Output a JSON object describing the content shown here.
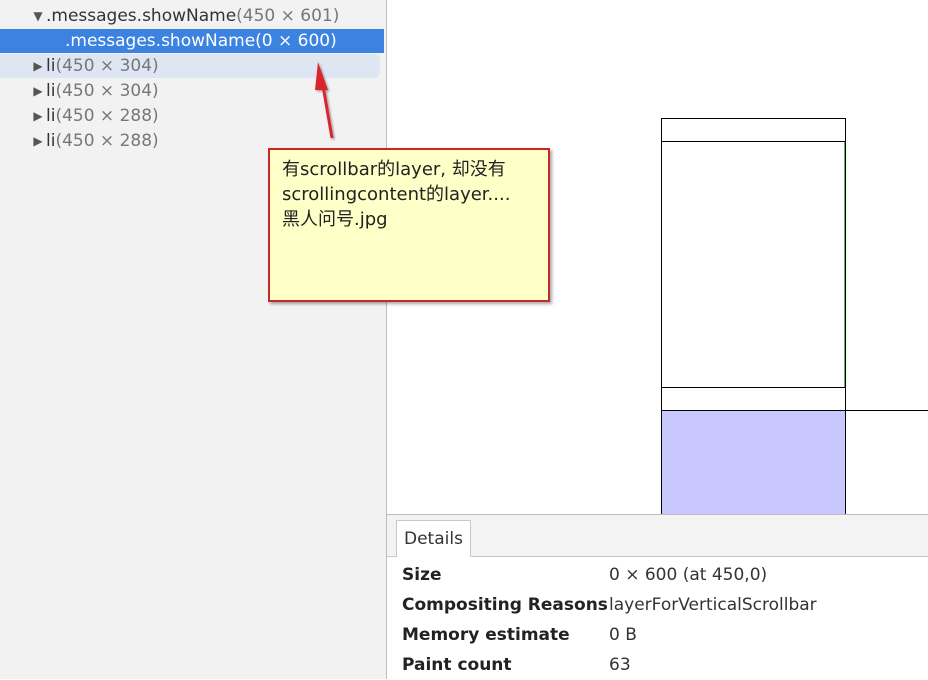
{
  "tree": {
    "rows": [
      {
        "name": ".messages.showName",
        "dims": "(450 × 601)",
        "expanded": true
      },
      {
        "name": ".messages.showName",
        "dims": "(0 × 600)",
        "selected": true
      },
      {
        "name": "li",
        "dims": "(450 × 304)"
      },
      {
        "name": "li",
        "dims": "(450 × 304)"
      },
      {
        "name": "li",
        "dims": "(450 × 288)"
      },
      {
        "name": "li",
        "dims": "(450 × 288)"
      }
    ],
    "expanded_arrow": "▼",
    "collapsed_arrow": "▶"
  },
  "annotation": {
    "text_line1": "有scrollbar的layer, 却没有",
    "text_line2": "scrollingcontent的layer....",
    "text_line3": "黑人问号.jpg",
    "border_color": "#c8262a",
    "background_color": "#ffffc8"
  },
  "details": {
    "tab_label": "Details",
    "rows": [
      {
        "key": "Size",
        "value": "0 × 600 (at 450,0)"
      },
      {
        "key": "Compositing Reasons",
        "value": "layerForVerticalScrollbar"
      },
      {
        "key": "Memory estimate",
        "value": "0 B"
      },
      {
        "key": "Paint count",
        "value": "63"
      }
    ]
  },
  "colors": {
    "selection": "#3c82e0",
    "hover": "#dde6f2",
    "layer_fill": "#c8c8ff",
    "scrollbar_line": "#4fc24f"
  }
}
